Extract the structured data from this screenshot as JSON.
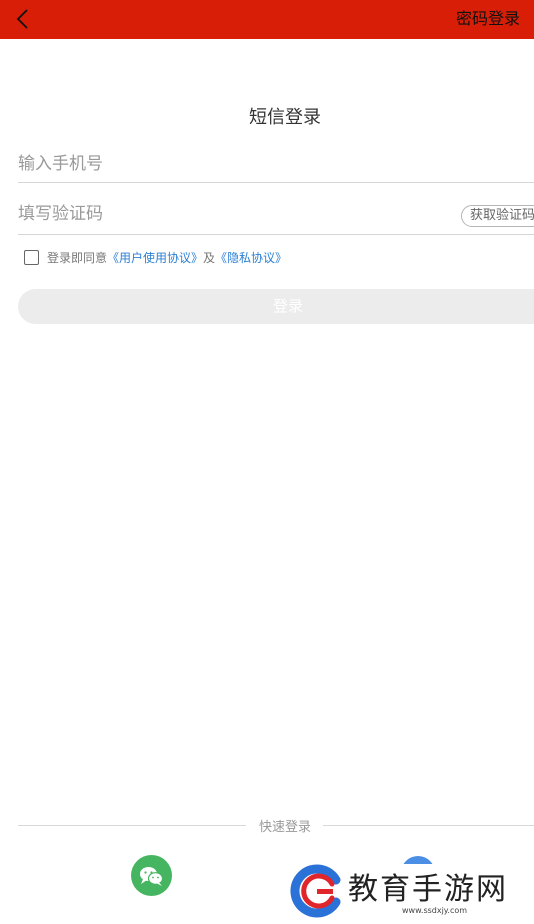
{
  "header": {
    "back_icon": "chevron-left-icon",
    "password_login": "密码登录",
    "bar_color": "#d81e06"
  },
  "main": {
    "title": "短信登录",
    "phone_placeholder": "输入手机号",
    "code_placeholder": "填写验证码",
    "get_code": "获取验证码",
    "agreement": {
      "prefix": "登录即同意",
      "user_agreement": "《用户使用协议》",
      "conjunction": "及",
      "privacy": "《隐私协议》",
      "checked": false
    },
    "login_button": "登录"
  },
  "footer": {
    "quick_login": "快速登录",
    "wechat_icon": "wechat-icon",
    "wechat_color": "#45b561"
  },
  "watermark": {
    "text": "教育手游网",
    "url": "www.ssdxjy.com"
  }
}
